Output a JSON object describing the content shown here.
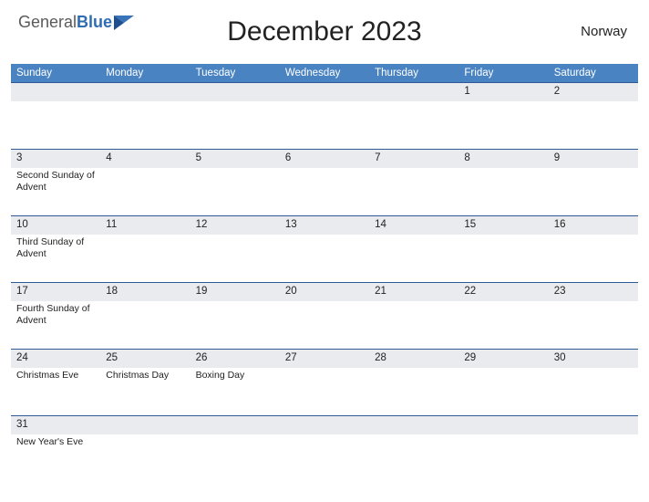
{
  "logo": {
    "part1": "General",
    "part2": "Blue"
  },
  "title": "December 2023",
  "country": "Norway",
  "day_headers": [
    "Sunday",
    "Monday",
    "Tuesday",
    "Wednesday",
    "Thursday",
    "Friday",
    "Saturday"
  ],
  "weeks": [
    {
      "dates": [
        "",
        "",
        "",
        "",
        "",
        "1",
        "2"
      ],
      "events": [
        "",
        "",
        "",
        "",
        "",
        "",
        ""
      ]
    },
    {
      "dates": [
        "3",
        "4",
        "5",
        "6",
        "7",
        "8",
        "9"
      ],
      "events": [
        "Second Sunday of Advent",
        "",
        "",
        "",
        "",
        "",
        ""
      ]
    },
    {
      "dates": [
        "10",
        "11",
        "12",
        "13",
        "14",
        "15",
        "16"
      ],
      "events": [
        "Third Sunday of Advent",
        "",
        "",
        "",
        "",
        "",
        ""
      ]
    },
    {
      "dates": [
        "17",
        "18",
        "19",
        "20",
        "21",
        "22",
        "23"
      ],
      "events": [
        "Fourth Sunday of Advent",
        "",
        "",
        "",
        "",
        "",
        ""
      ]
    },
    {
      "dates": [
        "24",
        "25",
        "26",
        "27",
        "28",
        "29",
        "30"
      ],
      "events": [
        "Christmas Eve",
        "Christmas Day",
        "Boxing Day",
        "",
        "",
        "",
        ""
      ]
    },
    {
      "dates": [
        "31",
        "",
        "",
        "",
        "",
        "",
        ""
      ],
      "events": [
        "New Year's Eve",
        "",
        "",
        "",
        "",
        "",
        ""
      ]
    }
  ]
}
